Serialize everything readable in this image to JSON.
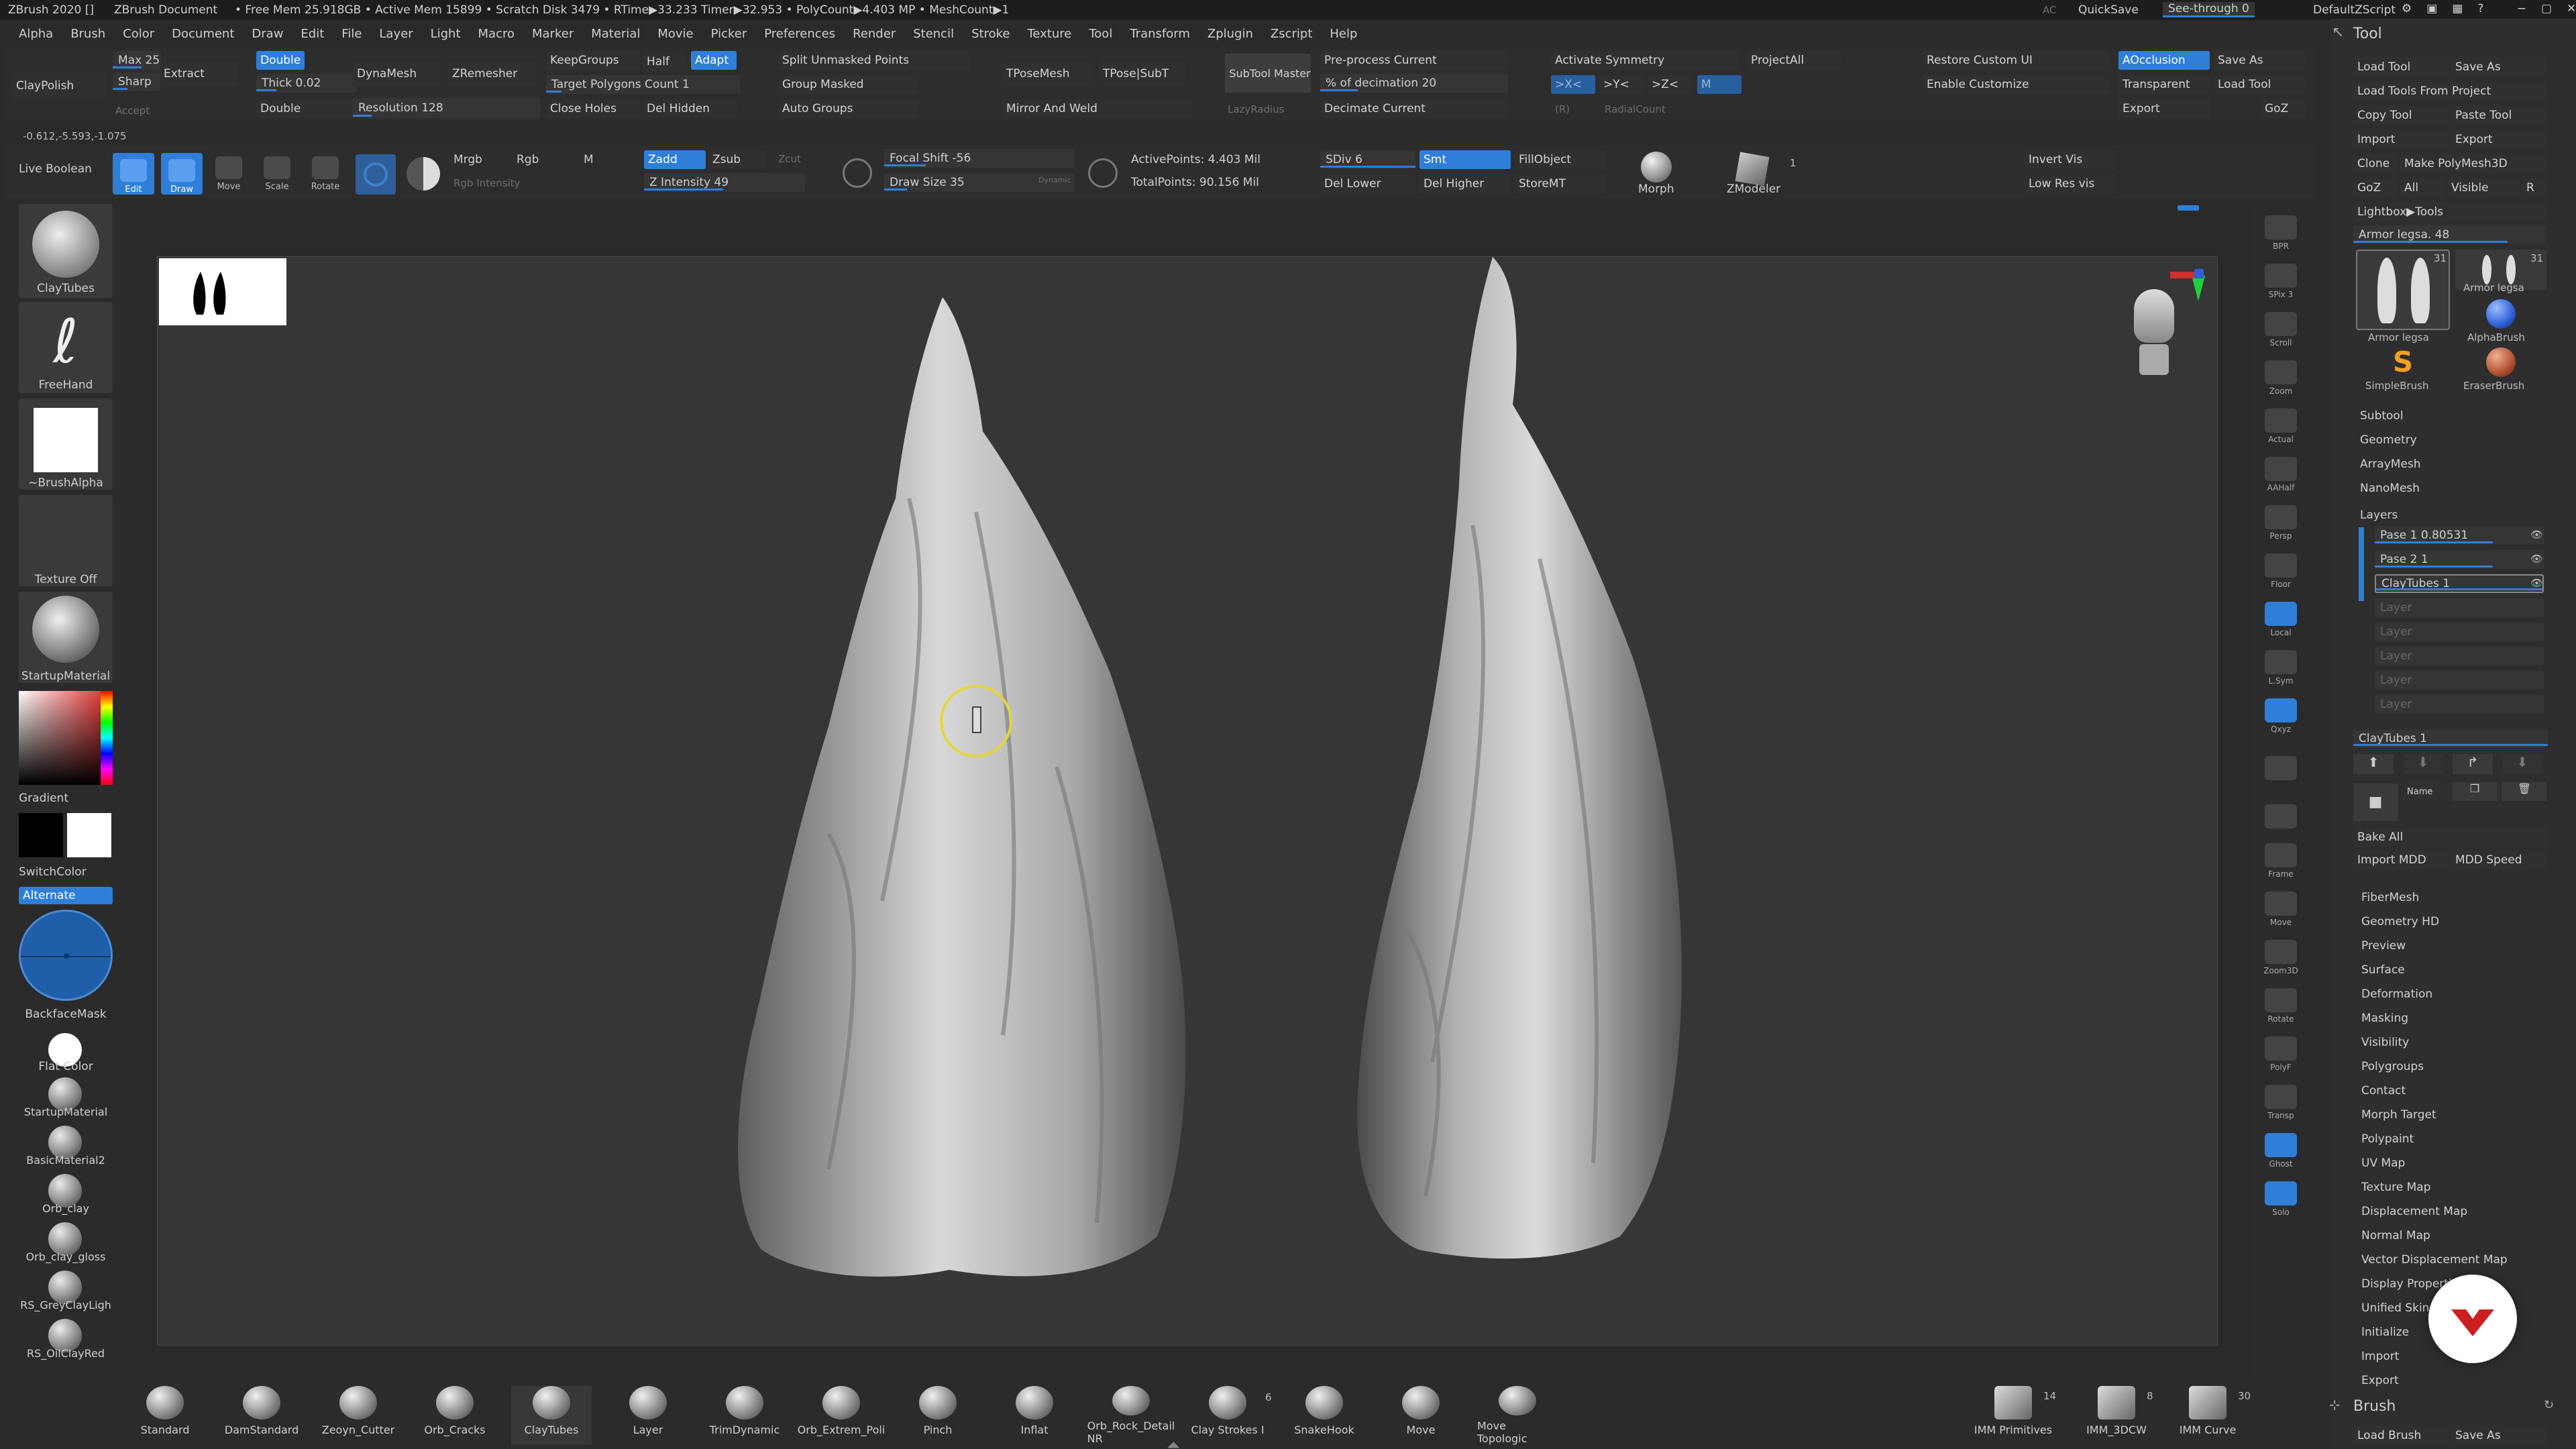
{
  "titlebar": {
    "app": "ZBrush 2020 []",
    "doc": "ZBrush Document",
    "stats": "• Free Mem 25.918GB • Active Mem 15899 • Scratch Disk 3479 • RTime▶33.233 Timer▶32.953 • PolyCount▶4.403 MP • MeshCount▶1",
    "ac": "AC",
    "quicksave": "QuickSave",
    "seethrough": "See-through 0",
    "script": "DefaultZScript"
  },
  "menu": [
    "Alpha",
    "Brush",
    "Color",
    "Document",
    "Draw",
    "Edit",
    "File",
    "Layer",
    "Light",
    "Macro",
    "Marker",
    "Material",
    "Movie",
    "Picker",
    "Preferences",
    "Render",
    "Stencil",
    "Stroke",
    "Texture",
    "Tool",
    "Transform",
    "Zplugin",
    "Zscript",
    "Help"
  ],
  "toolbar1": {
    "claypolish": "ClayPolish",
    "max": "Max 25",
    "sharp": "Sharp",
    "accept": "Accept",
    "extract": "Extract",
    "double1": "Double",
    "thick": "Thick 0.02",
    "double2": "Double",
    "dynamesh": "DynaMesh",
    "resolution": "Resolution 128",
    "zremesher": "ZRemesher",
    "keepgroups": "KeepGroups",
    "half": "Half",
    "adapt": "Adapt",
    "target": "Target Polygons Count 1",
    "closeholes": "Close Holes",
    "delhidden": "Del Hidden",
    "splitunmasked": "Split Unmasked Points",
    "groupmasked": "Group Masked",
    "autogroups": "Auto Groups",
    "tposemesh": "TPoseMesh",
    "tposesubt": "TPose|SubT",
    "mirrorweld": "Mirror And Weld",
    "subtoolmaster": "SubTool Master",
    "lazyradius": "LazyRadius",
    "preprocess": "Pre-process Current",
    "decimation": "% of decimation 20",
    "decimatecurrent": "Decimate Current",
    "activatesym": "Activate Symmetry",
    "projectall": "ProjectAll",
    "x": ">X<",
    "y": ">Y<",
    "z": ">Z<",
    "m": "M",
    "r": "(R)",
    "radialcount": "RadialCount",
    "restorecustom": "Restore Custom UI",
    "enablecustom": "Enable Customize",
    "aocclusion": "AOcclusion",
    "transparent": "Transparent",
    "export": "Export",
    "saveas": "Save As",
    "loadtool": "Load Tool",
    "goz": "GoZ"
  },
  "coords": "-0.612,-5.593,-1.075",
  "toolbar2": {
    "liveboolean": "Live Boolean",
    "edit": "Edit",
    "draw": "Draw",
    "move": "Move",
    "scale": "Scale",
    "rotate": "Rotate",
    "mrgb": "Mrgb",
    "rgb": "Rgb",
    "m": "M",
    "rgbintensity": "Rgb Intensity",
    "zadd": "Zadd",
    "zsub": "Zsub",
    "zcut": "Zcut",
    "zintensity": "Z Intensity 49",
    "focalshift": "Focal Shift -56",
    "drawsize": "Draw Size 35",
    "dynamic": "Dynamic",
    "activepoints": "ActivePoints: 4.403 Mil",
    "totalpoints": "TotalPoints: 90.156 Mil",
    "sdiv": "SDiv 6",
    "smt": "Smt",
    "dellower": "Del Lower",
    "delhigher": "Del Higher",
    "fillobject": "FillObject",
    "storemt": "StoreMT",
    "morph": "Morph",
    "zmodeler": "ZModeler",
    "zmcount": "1",
    "invertvis": "Invert Vis",
    "lowresvis": "Low Res vis"
  },
  "leftshelf": {
    "claytubes": "ClayTubes",
    "freehand": "FreeHand",
    "brushalpha": "~BrushAlpha",
    "textureoff": "Texture Off",
    "startupmat": "StartupMaterial",
    "gradient": "Gradient",
    "switchcolor": "SwitchColor",
    "alternate": "Alternate",
    "backfacemask": "BackfaceMask",
    "flatcolor": "Flat Color",
    "materials": [
      "StartupMaterial",
      "BasicMaterial2",
      "Orb_clay",
      "Orb_clay_gloss",
      "RS_GreyClayLigh",
      "RS_OilClayRed"
    ]
  },
  "righticons": [
    "BPR",
    "SPix 3",
    "Scroll",
    "Zoom",
    "Actual",
    "AAHalf",
    "Persp",
    "Floor",
    "Local",
    "L.Sym",
    "Qxyz",
    "",
    "",
    "Frame",
    "Move",
    "Zoom3D",
    "Rotate",
    "PolyF",
    "Transp",
    "Ghost",
    "Solo"
  ],
  "toolpanel": {
    "title": "Tool",
    "loadtool": "Load Tool",
    "saveas": "Save As",
    "loadfromproject": "Load Tools From Project",
    "copytool": "Copy Tool",
    "pastetool": "Paste Tool",
    "import": "Import",
    "export": "Export",
    "clone": "Clone",
    "makepolymesh": "Make PolyMesh3D",
    "goz": "GoZ",
    "all": "All",
    "visible": "Visible",
    "r": "R",
    "lightbox": "Lightbox▶Tools",
    "armor": "Armor legsa. 48",
    "thumbs": [
      "Armor legsa",
      "Armor legsa",
      "AlphaBrush",
      "SimpleBrush",
      "EraserBrush"
    ],
    "count1": "31",
    "count2": "31",
    "sections1": [
      "Subtool",
      "Geometry",
      "ArrayMesh",
      "NanoMesh"
    ],
    "layers": "Layers",
    "layerrows": [
      "Pase 1 0.80531",
      "Pase 2 1",
      "ClayTubes 1",
      "Layer",
      "Layer",
      "Layer",
      "Layer",
      "Layer"
    ],
    "claytubes": "ClayTubes 1",
    "name": "Name",
    "bakeall": "Bake All",
    "importmdd": "Import MDD",
    "mddspeed": "MDD Speed",
    "sections2": [
      "FiberMesh",
      "Geometry HD",
      "Preview",
      "Surface",
      "Deformation",
      "Masking",
      "Visibility",
      "Polygroups",
      "Contact",
      "Morph Target",
      "Polypaint",
      "UV Map",
      "Texture Map",
      "Displacement Map",
      "Normal Map",
      "Vector Displacement Map",
      "Display Properties",
      "Unified Skin",
      "Initialize",
      "Import",
      "Export"
    ],
    "brush": "Brush",
    "loadbrush": "Load Brush",
    "brushsaveas": "Save As"
  },
  "bottombrushes": [
    "Standard",
    "DamStandard",
    "Zeoyn_Cutter",
    "Orb_Cracks",
    "ClayTubes",
    "Layer",
    "TrimDynamic",
    "Orb_Extrem_Poli",
    "Pinch",
    "Inflat",
    "Orb_Rock_Detail NR",
    "Clay Strokes I",
    "SnakeHook",
    "Move",
    "Move Topologic"
  ],
  "bottomcount": "6",
  "imm": [
    {
      "label": "IMM Primitives",
      "count": "14"
    },
    {
      "label": "IMM_3DCW",
      "count": "8"
    },
    {
      "label": "IMM Curve",
      "count": "30"
    }
  ],
  "colors": {
    "accent": "#2f7fd8",
    "bg": "#2a2a2a",
    "canvas": "#3a3a3a"
  }
}
